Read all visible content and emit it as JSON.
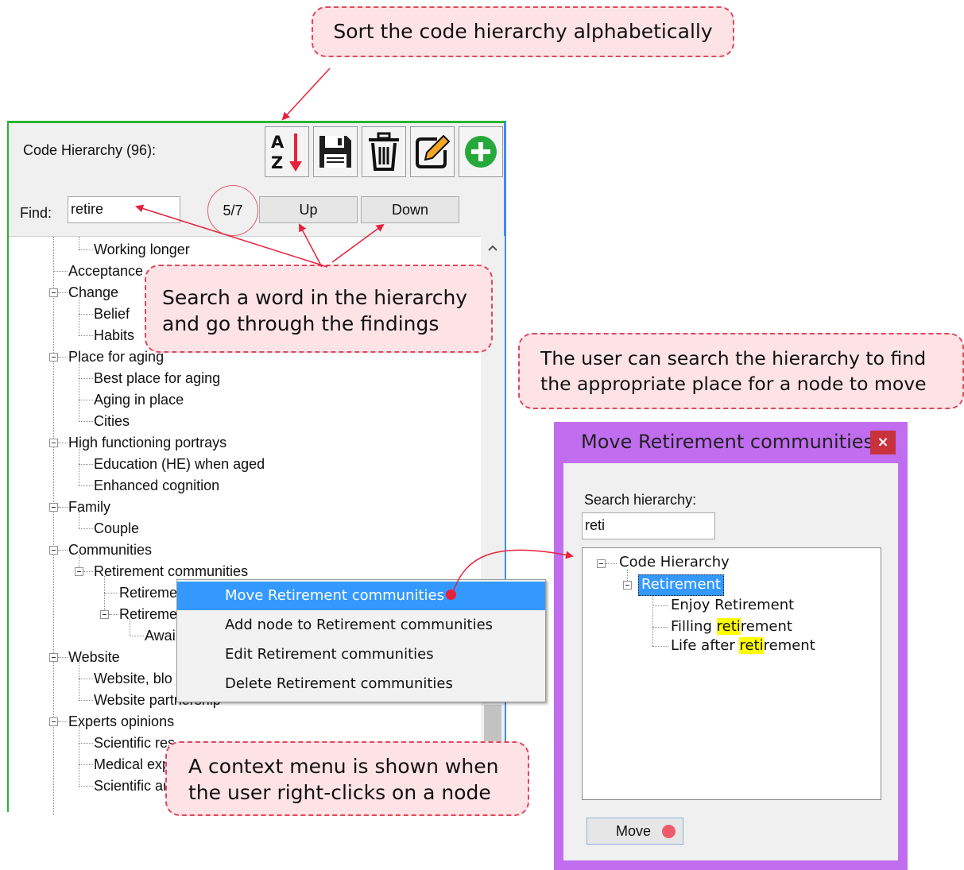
{
  "callouts": {
    "sort": "Sort the code hierarchy alphabetically",
    "search_line1": "Search a word in the hierarchy",
    "search_line2": "and go through the findings",
    "move_line1": "The user can search the hierarchy to find",
    "move_line2": "the appropriate place for a node to move",
    "context_line1": "A context menu is shown when",
    "context_line2": "the user right-clicks on a node"
  },
  "panel": {
    "title": "Code Hierarchy (96):",
    "find_label": "Find:",
    "find_value": "retire",
    "match_counter": "5/7",
    "up_label": "Up",
    "down_label": "Down",
    "toolbar_icons": [
      "sort-az-icon",
      "save-icon",
      "trash-icon",
      "edit-icon",
      "add-icon"
    ],
    "tree": [
      "Working longer",
      "Acceptance",
      "Change",
      "Belief",
      "Habits",
      "Place for aging",
      "Best place for aging",
      "Aging in place",
      "Cities",
      "High functioning portrays",
      "Education (HE) when aged",
      "Enhanced cognition",
      "Family",
      "Couple",
      "Communities",
      "Retirement communities",
      "Retireme",
      "Retireme",
      "Awai",
      "Website",
      "Website, blo",
      "Website partnership",
      "Experts opinions",
      "Scientific res",
      "Medical exp",
      "Scientific ar"
    ]
  },
  "context_menu": {
    "items": [
      "Move Retirement communities",
      "Add node to Retirement communities",
      "Edit Retirement communities",
      "Delete Retirement communities"
    ]
  },
  "move_dialog": {
    "title": "Move Retirement communities",
    "close_label": "×",
    "search_label": "Search hierarchy:",
    "search_value": "reti",
    "tree": {
      "root": "Code Hierarchy",
      "selected": "Retirement",
      "child1": "Enjoy Retirement",
      "child2_pre": "Filling ",
      "child2_hl": "reti",
      "child2_post": "rement",
      "child3_pre": "Life after ",
      "child3_hl": "reti",
      "child3_post": "rement"
    },
    "move_label": "Move"
  },
  "colors": {
    "callout_fill": "#fde3e6",
    "callout_border": "#e0485a",
    "arrow": "#e8213a",
    "panel_border": "#28b431",
    "dialog": "#c16df0",
    "menu_highlight": "#3399ff",
    "search_highlight": "#ffff00"
  }
}
